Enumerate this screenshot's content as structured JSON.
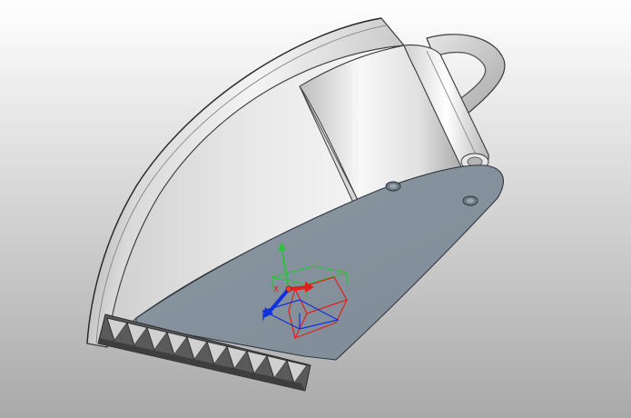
{
  "viewport": {
    "name": "cad-3d-viewport",
    "background_top": "#ffffff",
    "background_bottom": "#a9a9a9"
  },
  "model": {
    "name": "excavator-bucket",
    "colors": {
      "shell_light": "#f2f2f2",
      "shell_mid": "#d6d6d6",
      "shell_dark": "#9a9a9a",
      "edge": "#3a3a3a",
      "side_plate": "#8794a0",
      "teeth_dark": "#5a5a5a",
      "teeth_light": "#d0d0d0"
    },
    "features": [
      "curved-shell",
      "rear-lip-flange",
      "hinge-pin-tube",
      "side-plate",
      "mount-holes",
      "cutting-teeth"
    ],
    "tooth_count": 10
  },
  "triad": {
    "name": "coordinate-triad",
    "axis_x_label": "X",
    "axis_x_color": "#e0201a",
    "axis_y_color": "#30c040",
    "axis_z_color": "#1030e0"
  }
}
